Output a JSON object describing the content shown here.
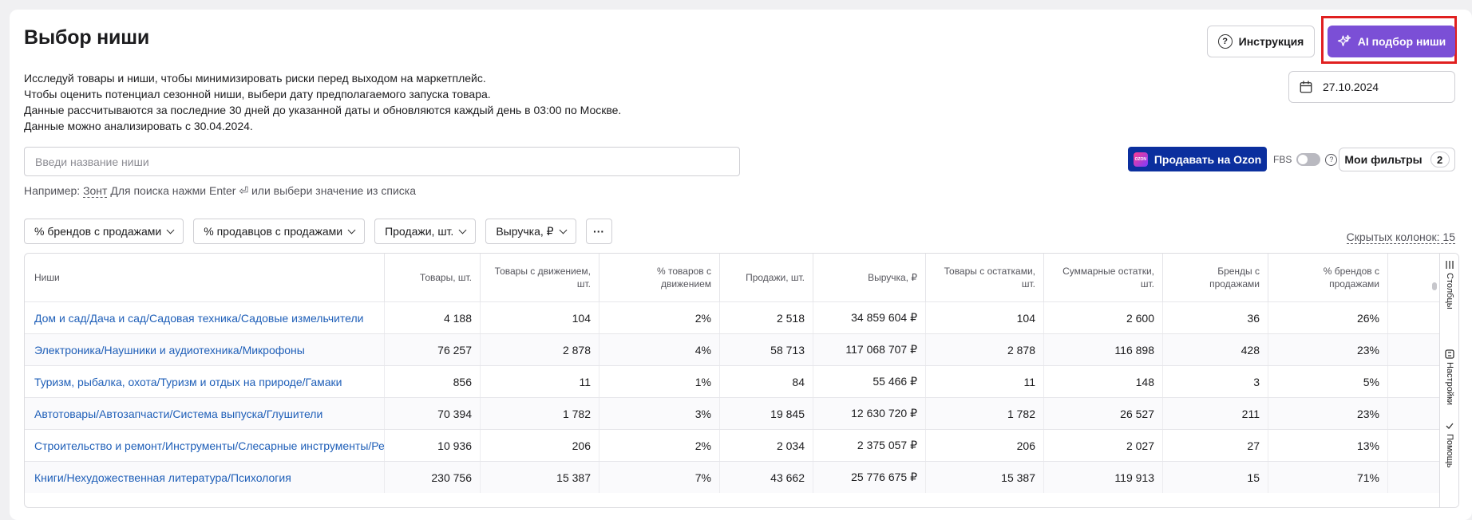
{
  "header": {
    "title": "Выбор ниши",
    "description": [
      "Исследуй товары и ниши, чтобы минимизировать риски перед выходом на маркетплейс.",
      "Чтобы оценить потенциал сезонной ниши, выбери дату предполагаемого запуска товара.",
      "Данные рассчитываются за последние 30 дней до указанной даты и обновляются каждый день в 03:00 по Москве.",
      "Данные можно анализировать с 30.04.2024."
    ],
    "instruction_label": "Инструкция",
    "ai_label": "AI подбор ниши",
    "date_value": "27.10.2024"
  },
  "search": {
    "placeholder": "Введи название ниши",
    "hint_prefix": "Например:",
    "hint_example": "Зонт",
    "hint_suffix": "Для поиска нажми Enter ⏎ или выбери значение из списка"
  },
  "toolbar": {
    "ozon_label": "Продавать на Ozon",
    "ozon_logo_text": "OZON",
    "fbs_label": "FBS",
    "filters_label": "Мои фильтры",
    "filters_count": "2"
  },
  "chips": [
    "% брендов с продажами",
    "% продавцов с продажами",
    "Продажи, шт.",
    "Выручка, ₽"
  ],
  "more_label": "···",
  "hidden_columns_label": "Скрытых колонок: 15",
  "table": {
    "headers": [
      [
        "Ниши"
      ],
      [
        "Товары, шт."
      ],
      [
        "Товары с движением,",
        "шт."
      ],
      [
        "% товаров с",
        "движением"
      ],
      [
        "Продажи, шт."
      ],
      [
        "Выручка, ₽"
      ],
      [
        "Товары с остатками,",
        "шт."
      ],
      [
        "Суммарные остатки,",
        "шт."
      ],
      [
        "Бренды с",
        "продажами"
      ],
      [
        "% брендов с",
        "продажами"
      ]
    ],
    "rows": [
      [
        "Дом и сад/Дача и сад/Садовая техника/Садовые измельчители",
        "4 188",
        "104",
        "2%",
        "2 518",
        "34 859 604 ₽",
        "104",
        "2 600",
        "36",
        "26%"
      ],
      [
        "Электроника/Наушники и аудиотехника/Микрофоны",
        "76 257",
        "2 878",
        "4%",
        "58 713",
        "117 068 707 ₽",
        "2 878",
        "116 898",
        "428",
        "23%"
      ],
      [
        "Туризм, рыбалка, охота/Туризм и отдых на природе/Гамаки",
        "856",
        "11",
        "1%",
        "84",
        "55 466 ₽",
        "11",
        "148",
        "3",
        "5%"
      ],
      [
        "Автотовары/Автозапчасти/Система выпуска/Глушители",
        "70 394",
        "1 782",
        "3%",
        "19 845",
        "12 630 720 ₽",
        "1 782",
        "26 527",
        "211",
        "23%"
      ],
      [
        "Строительство и ремонт/Инструменты/Слесарные инструменты/Резьбонарезной инструмент",
        "10 936",
        "206",
        "2%",
        "2 034",
        "2 375 057 ₽",
        "206",
        "2 027",
        "27",
        "13%"
      ],
      [
        "Книги/Нехудожественная литература/Психология",
        "230 756",
        "15 387",
        "7%",
        "43 662",
        "25 776 675 ₽",
        "15 387",
        "119 913",
        "15",
        "71%"
      ]
    ]
  },
  "side_tabs": [
    "Столбцы",
    "Настройки",
    "Помощь"
  ]
}
